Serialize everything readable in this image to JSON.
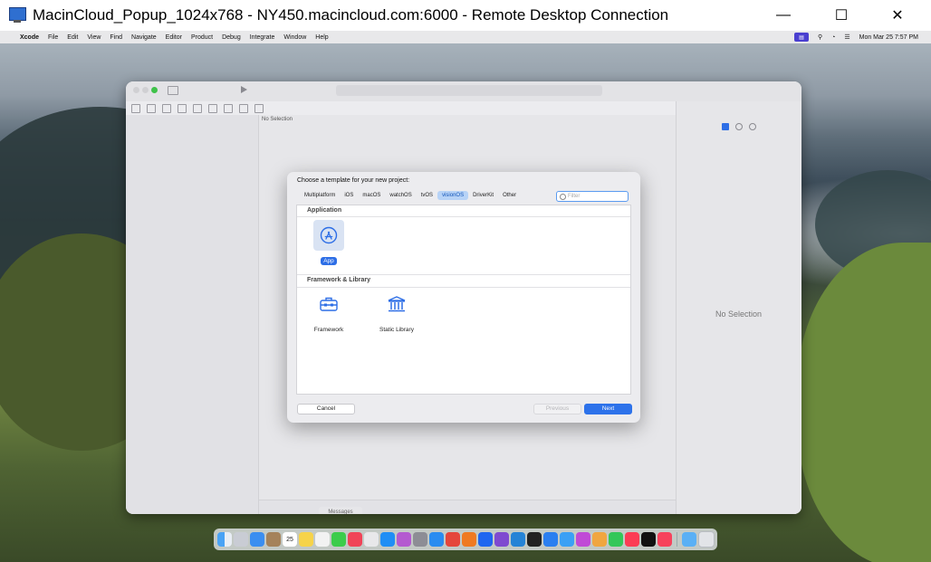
{
  "rdp": {
    "title": "MacinCloud_Popup_1024x768 - NY450.macincloud.com:6000 - Remote Desktop Connection",
    "minimize_glyph": "—",
    "maximize_glyph": "☐",
    "close_glyph": "✕"
  },
  "menubar": {
    "apple_glyph": "",
    "items": [
      "Xcode",
      "File",
      "Edit",
      "View",
      "Find",
      "Navigate",
      "Editor",
      "Product",
      "Debug",
      "Integrate",
      "Window",
      "Help"
    ],
    "datetime": "Mon Mar 25  7:57 PM"
  },
  "xcode": {
    "editor_no_selection": "No Selection",
    "inspector_no_selection": "No Selection",
    "messages_tip": "Messages"
  },
  "dialog": {
    "title": "Choose a template for your new project:",
    "tabs": [
      "Multiplatform",
      "iOS",
      "macOS",
      "watchOS",
      "tvOS",
      "visionOS",
      "DriverKit",
      "Other"
    ],
    "selected_tab": "visionOS",
    "filter_placeholder": "Filter",
    "sections": {
      "application": "Application",
      "framework": "Framework & Library"
    },
    "templates": {
      "app": "App",
      "framework": "Framework",
      "static_library": "Static Library"
    },
    "selected_template": "App",
    "buttons": {
      "cancel": "Cancel",
      "previous": "Previous",
      "next": "Next"
    }
  },
  "dock": {
    "calendar_day": "25",
    "apps": [
      "finder-icon",
      "launchpad-icon",
      "mail-icon",
      "contacts-icon",
      "calendar-icon",
      "notes-icon",
      "reminders-icon",
      "messages-icon",
      "news-icon",
      "files-icon",
      "app-store-icon",
      "photos-icon",
      "system-settings-icon",
      "safari-icon",
      "chrome-icon",
      "firefox-icon",
      "dropbox-icon",
      "visual-studio-icon",
      "vscode-icon",
      "terminal-icon",
      "xcode-icon",
      "testflight-icon",
      "instruments-icon",
      "photos-app-icon",
      "facetime-icon",
      "music-icon",
      "appletv-icon",
      "itunes-icon",
      "downloads-icon",
      "trash-icon"
    ],
    "colors": {
      "accent": "#2d72ea"
    }
  }
}
